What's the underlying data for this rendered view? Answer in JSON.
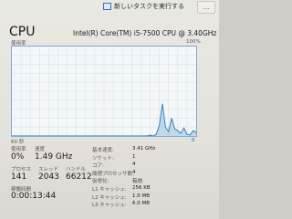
{
  "header": {
    "new_task_label": "新しいタスクを実行する",
    "window_control": "..."
  },
  "cpu": {
    "title": "CPU",
    "model": "Intel(R) Core(TM) i5-7500 CPU @ 3.40GHz",
    "graph_label_left": "使用率",
    "graph_label_right": "100%",
    "graph_time_label": "60 秒",
    "graph_min_label": "0"
  },
  "chart_data": {
    "type": "area",
    "title": "",
    "xlabel": "",
    "ylabel": "使用率",
    "ylim": [
      0,
      100
    ],
    "x": [
      0,
      1,
      2,
      3,
      4,
      5,
      6,
      7,
      8,
      9,
      10,
      11,
      12,
      13,
      14,
      15,
      16,
      17,
      18,
      19,
      20,
      21,
      22,
      23,
      24,
      25,
      26,
      27,
      28,
      29,
      30,
      31,
      32,
      33,
      34,
      35,
      36,
      37,
      38,
      39,
      40,
      41,
      42,
      43,
      44,
      45,
      46,
      47,
      48,
      49,
      50,
      51,
      52,
      53,
      54,
      55,
      56,
      57,
      58,
      59,
      60
    ],
    "values": [
      0,
      0,
      0,
      0,
      0,
      0,
      0,
      0,
      0,
      0,
      0,
      0,
      0,
      0,
      0,
      0,
      0,
      0,
      0,
      0,
      0,
      0,
      0,
      0,
      0,
      0,
      0,
      0,
      0,
      0,
      0,
      0,
      0,
      0,
      0,
      0,
      0,
      0,
      0,
      0,
      0,
      0,
      0,
      0,
      0,
      1,
      0,
      2,
      12,
      36,
      10,
      5,
      20,
      8,
      6,
      3,
      9,
      2,
      1,
      6,
      4
    ]
  },
  "stats": {
    "utilization_label": "使用率",
    "utilization_value": "0%",
    "speed_label": "速度",
    "speed_value": "1.49 GHz",
    "processes_label": "プロセス",
    "processes_value": "141",
    "threads_label": "スレッド",
    "threads_value": "2043",
    "handles_label": "ハンドル",
    "handles_value": "66212",
    "uptime_label": "稼働時間",
    "uptime_value": "0:00:13:44"
  },
  "details": [
    {
      "label": "基本速度:",
      "value": "3.41 GHz"
    },
    {
      "label": "ソケット:",
      "value": "1"
    },
    {
      "label": "コア:",
      "value": "4"
    },
    {
      "label": "論理プロセッサ数:",
      "value": "4"
    },
    {
      "label": "仮想化:",
      "value": "有効"
    },
    {
      "label": "L1 キャッシュ:",
      "value": "256 KB"
    },
    {
      "label": "L2 キャッシュ:",
      "value": "1.0 MB"
    },
    {
      "label": "L3 キャッシュ:",
      "value": "6.0 MB"
    }
  ]
}
